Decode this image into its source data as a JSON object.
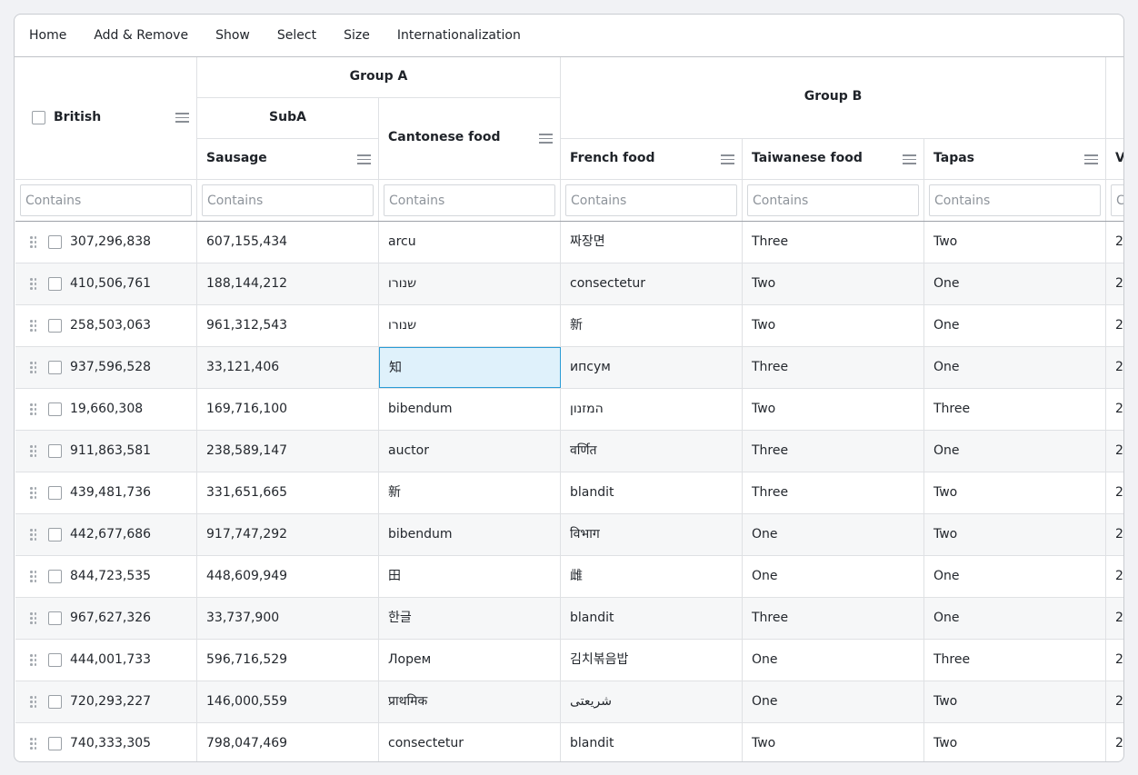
{
  "menu": [
    "Home",
    "Add & Remove",
    "Show",
    "Select",
    "Size",
    "Internationalization"
  ],
  "headers": {
    "british": "British",
    "group_a": "Group A",
    "sub_a": "SubA",
    "sausage": "Sausage",
    "cantonese": "Cantonese food",
    "group_b": "Group B",
    "french": "French food",
    "taiwanese": "Taiwanese food",
    "tapas": "Tapas",
    "partial": "V"
  },
  "filter_placeholder": "Contains",
  "partial_placeholder": "C",
  "partial_cell": "2",
  "rows": [
    {
      "british": "307,296,838",
      "sausage": "607,155,434",
      "cantonese": "arcu",
      "french": "짜장면",
      "taiwanese": "Three",
      "tapas": "Two"
    },
    {
      "british": "410,506,761",
      "sausage": "188,144,212",
      "cantonese": "שנורו",
      "french": "consectetur",
      "taiwanese": "Two",
      "tapas": "One"
    },
    {
      "british": "258,503,063",
      "sausage": "961,312,543",
      "cantonese": "שנורו",
      "french": "新",
      "taiwanese": "Two",
      "tapas": "One"
    },
    {
      "british": "937,596,528",
      "sausage": "33,121,406",
      "cantonese": "知",
      "french": "ипсум",
      "taiwanese": "Three",
      "tapas": "One"
    },
    {
      "british": "19,660,308",
      "sausage": "169,716,100",
      "cantonese": "bibendum",
      "french": "המזנון",
      "taiwanese": "Two",
      "tapas": "Three"
    },
    {
      "british": "911,863,581",
      "sausage": "238,589,147",
      "cantonese": "auctor",
      "french": "वर्णित",
      "taiwanese": "Three",
      "tapas": "One"
    },
    {
      "british": "439,481,736",
      "sausage": "331,651,665",
      "cantonese": "新",
      "french": "blandit",
      "taiwanese": "Three",
      "tapas": "Two"
    },
    {
      "british": "442,677,686",
      "sausage": "917,747,292",
      "cantonese": "bibendum",
      "french": "विभाग",
      "taiwanese": "One",
      "tapas": "Two"
    },
    {
      "british": "844,723,535",
      "sausage": "448,609,949",
      "cantonese": "田",
      "french": "雌",
      "taiwanese": "One",
      "tapas": "One"
    },
    {
      "british": "967,627,326",
      "sausage": "33,737,900",
      "cantonese": "한글",
      "french": "blandit",
      "taiwanese": "Three",
      "tapas": "One"
    },
    {
      "british": "444,001,733",
      "sausage": "596,716,529",
      "cantonese": "Лорем",
      "french": "김치볶음밥",
      "taiwanese": "One",
      "tapas": "Three"
    },
    {
      "british": "720,293,227",
      "sausage": "146,000,559",
      "cantonese": "प्राथमिक",
      "french": "شريعتى",
      "taiwanese": "One",
      "tapas": "Two"
    },
    {
      "british": "740,333,305",
      "sausage": "798,047,469",
      "cantonese": "consectetur",
      "french": "blandit",
      "taiwanese": "Two",
      "tapas": "Two"
    }
  ],
  "focused_cell": {
    "row": 3,
    "column": "cantonese"
  }
}
